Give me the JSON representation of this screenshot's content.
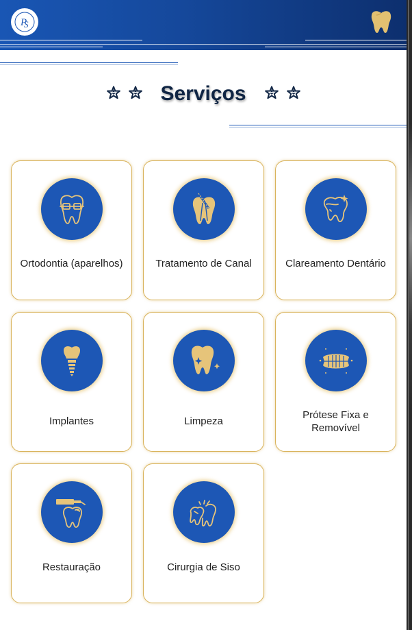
{
  "header": {
    "logo_alt": "PS",
    "accent": "#1d57b5",
    "gold": "#e6c47a"
  },
  "section": {
    "title": "Serviços"
  },
  "services": [
    {
      "label": "Ortodontia (aparelhos)",
      "icon": "braces-tooth-icon"
    },
    {
      "label": "Tratamento de Canal",
      "icon": "root-canal-icon"
    },
    {
      "label": "Clareamento Dentário",
      "icon": "whitening-tooth-icon"
    },
    {
      "label": "Implantes",
      "icon": "implant-icon"
    },
    {
      "label": "Limpeza",
      "icon": "sparkling-tooth-icon"
    },
    {
      "label": "Prótese Fixa e Removível",
      "icon": "denture-icon"
    },
    {
      "label": "Restauração",
      "icon": "restoration-icon"
    },
    {
      "label": "Cirurgia de Siso",
      "icon": "wisdom-tooth-icon"
    }
  ]
}
